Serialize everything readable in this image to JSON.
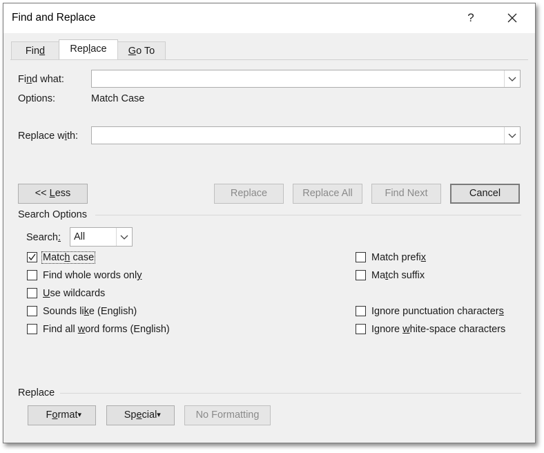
{
  "window": {
    "title": "Find and Replace",
    "help_label": "?"
  },
  "tabs": [
    {
      "label_pre": "Fin",
      "label_key": "d",
      "label_post": ""
    },
    {
      "label_pre": "Rep",
      "label_key": "l",
      "label_post": "ace"
    },
    {
      "label_pre": "",
      "label_key": "G",
      "label_post": "o To"
    }
  ],
  "find": {
    "label_pre": "Fi",
    "label_key": "n",
    "label_post": "d what:",
    "value": ""
  },
  "options": {
    "label": "Options:",
    "value": "Match Case"
  },
  "replace": {
    "label_pre": "Replace w",
    "label_key": "i",
    "label_post": "th:",
    "value": ""
  },
  "buttons": {
    "less_pre": "<< ",
    "less_key": "L",
    "less_post": "ess",
    "replace": "Replace",
    "replace_all": "Replace All",
    "find_next": "Find Next",
    "cancel": "Cancel"
  },
  "search_options": {
    "header": "Search Options",
    "search_label_pre": "Search",
    "search_label_key": ":",
    "search_value": "All",
    "left": [
      {
        "pre": "Matc",
        "key": "h",
        "post": " case",
        "checked": true
      },
      {
        "pre": "Find whole words onl",
        "key": "y",
        "post": "",
        "checked": false
      },
      {
        "pre": "",
        "key": "U",
        "post": "se wildcards",
        "checked": false
      },
      {
        "pre": "Sounds li",
        "key": "k",
        "post": "e (English)",
        "checked": false
      },
      {
        "pre": "Find all ",
        "key": "w",
        "post": "ord forms (English)",
        "checked": false
      }
    ],
    "right": [
      {
        "pre": "Match prefi",
        "key": "x",
        "post": "",
        "checked": false
      },
      {
        "pre": "Ma",
        "key": "t",
        "post": "ch suffix",
        "checked": false
      },
      {
        "pre": "Ignore punctuation character",
        "key": "s",
        "post": "",
        "checked": false
      },
      {
        "pre": "Ignore ",
        "key": "w",
        "post": "hite-space characters",
        "checked": false
      }
    ]
  },
  "replace_section": {
    "header": "Replace",
    "format_pre": "F",
    "format_key": "o",
    "format_post": "rmat",
    "special_pre": "Sp",
    "special_key": "e",
    "special_post": "cial",
    "no_formatting": "No Formatting"
  }
}
